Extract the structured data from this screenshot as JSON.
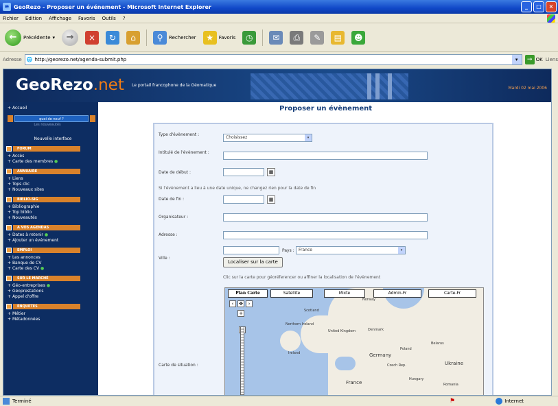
{
  "window": {
    "title": "GeoRezo - Proposer un événement - Microsoft Internet Explorer"
  },
  "menu": [
    "Fichier",
    "Edition",
    "Affichage",
    "Favoris",
    "Outils",
    "?"
  ],
  "toolbar": {
    "back": "Précédente",
    "search": "Rechercher",
    "favorites": "Favoris"
  },
  "address": {
    "label": "Adresse",
    "url": "http://georezo.net/agenda-submit.php",
    "go": "OK",
    "links": "Liens"
  },
  "header": {
    "logo": "GeoRezo",
    "logo_suffix": ".net",
    "tagline": "Le portail francophone de la Géomatique",
    "date": "Mardi 02 mai 2006"
  },
  "sidebar": {
    "accueil": "Accueil",
    "quoi_de_neuf": "quoi de neuf ?",
    "quoi_sub": "Les nouveautés",
    "nouvelle_interface": "Nouvelle interface",
    "sections": [
      {
        "title": "FORUM",
        "links": [
          "Accès",
          "Carte des membres"
        ]
      },
      {
        "title": "ANNUAIRE",
        "links": [
          "Liens",
          "Tops clic",
          "Nouveaux sites"
        ]
      },
      {
        "title": "BIBLIO-SIG",
        "links": [
          "Bibliographie",
          "Top biblio",
          "Nouveautés"
        ]
      },
      {
        "title": "A VOS AGENDAS",
        "links": [
          "Dates à retenir",
          "Ajouter un événement"
        ]
      },
      {
        "title": "EMPLOI",
        "links": [
          "Les annonces",
          "Banque de CV",
          "Carte des CV"
        ]
      },
      {
        "title": "SUR LE MARCHÉ",
        "links": [
          "Géo-entreprises",
          "Géoprestations",
          "Appel d'offre"
        ]
      },
      {
        "title": "ENQUETES",
        "links": [
          "Métier",
          "Métadonnées"
        ]
      }
    ]
  },
  "page": {
    "title": "Proposer un évènement"
  },
  "form": {
    "type_label": "Type d'évènement :",
    "type_value": "Choisissez",
    "intitule_label": "Intitulé de l'évènement :",
    "debut_label": "Date de début :",
    "note_date": "Si l'évènement a lieu à une date unique, ne changez rien pour la date de fin",
    "fin_label": "Date de fin :",
    "organisateur_label": "Organisateur :",
    "adresse_label": "Adresse :",
    "ville_label": "Ville :",
    "pays_label": "Pays :",
    "pays_value": "France",
    "localiser": "Localiser sur la carte",
    "note_carte": "Clic sur la carte pour géoréferencer ou affiner la localisation de l'évènement",
    "carte_label": "Carte de situation :"
  },
  "map": {
    "types": [
      "Plan Carte",
      "Satellite",
      "Mixte",
      "Admin-Fr",
      "Carte-Fr"
    ],
    "places": [
      "Norway",
      "Scotland",
      "Northern Ireland",
      "United Kingdom",
      "Ireland",
      "Denmark",
      "Belarus",
      "Poland",
      "Germany",
      "Czech Rep.",
      "Ukraine",
      "France",
      "Hungary",
      "Romania"
    ]
  },
  "status": {
    "text": "Terminé",
    "zone": "Internet"
  }
}
